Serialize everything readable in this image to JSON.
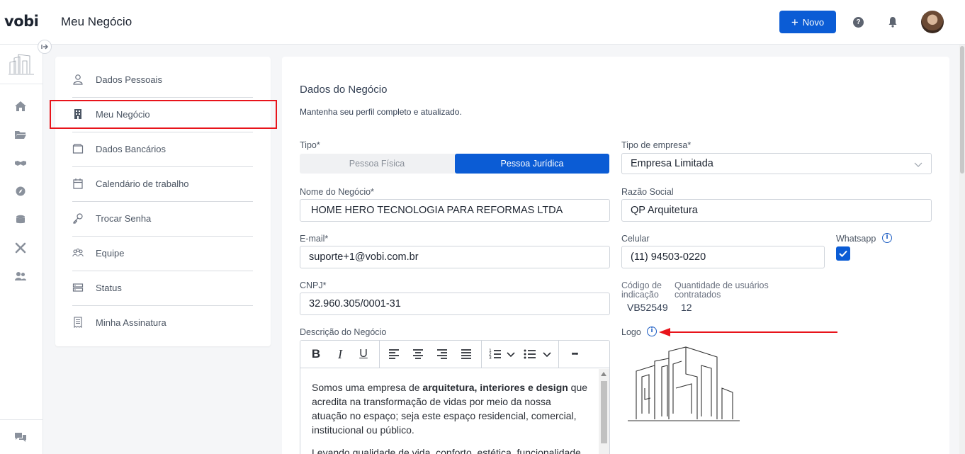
{
  "app": {
    "logo": "vobi",
    "page_title": "Meu Negócio"
  },
  "header": {
    "new_button": "Novo",
    "help_icon": "question-circle-icon",
    "bell_icon": "bell-icon"
  },
  "rail": {
    "icons": [
      "home-icon",
      "folder-icon",
      "handshake-icon",
      "compass-icon",
      "coins-icon",
      "tools-icon",
      "users-icon"
    ],
    "bottom_icon": "chat-icon"
  },
  "menu": {
    "items": [
      {
        "label": "Dados Pessoais",
        "icon": "user-icon"
      },
      {
        "label": "Meu Negócio",
        "icon": "building-icon"
      },
      {
        "label": "Dados Bancários",
        "icon": "wallet-icon"
      },
      {
        "label": "Calendário de trabalho",
        "icon": "calendar-icon"
      },
      {
        "label": "Trocar Senha",
        "icon": "key-icon"
      },
      {
        "label": "Equipe",
        "icon": "team-icon"
      },
      {
        "label": "Status",
        "icon": "server-icon"
      },
      {
        "label": "Minha Assinatura",
        "icon": "receipt-icon"
      }
    ]
  },
  "form": {
    "title": "Dados do Negócio",
    "subtitle": "Mantenha seu perfil completo e atualizado.",
    "tipo": {
      "label": "Tipo*",
      "options": [
        "Pessoa Física",
        "Pessoa Jurídica"
      ],
      "selected": "Pessoa Jurídica"
    },
    "tipo_empresa": {
      "label": "Tipo de empresa*",
      "value": "Empresa Limitada"
    },
    "nome": {
      "label": "Nome do Negócio*",
      "value": "HOME HERO TECNOLOGIA PARA REFORMAS LTDA"
    },
    "razao": {
      "label": "Razão Social",
      "value": "QP Arquitetura"
    },
    "email": {
      "label": "E-mail*",
      "value": "suporte+1@vobi.com.br"
    },
    "celular": {
      "label": "Celular",
      "value": "(11) 94503-0220"
    },
    "whatsapp": {
      "label": "Whatsapp",
      "checked": true
    },
    "cnpj": {
      "label": "CNPJ*",
      "value": "32.960.305/0001-31"
    },
    "codigo": {
      "label_line1": "Código de",
      "label_line2": "indicação",
      "value": "VB52549"
    },
    "quantidade": {
      "label_line1": "Quantidade de usuários",
      "label_line2": "contratados",
      "value": "12"
    },
    "descricao": {
      "label": "Descrição do Negócio",
      "p1_before": "Somos uma empresa de ",
      "p1_bold": "arquitetura, interiores e design",
      "p1_after": " que acredita na transformação de vidas por meio da nossa atuação no espaço; seja este espaço residencial, comercial, institucional ou público.",
      "p2": "Levando qualidade de vida, conforto, estética, funcionalidade"
    },
    "logo_label": "Logo"
  },
  "toolbar": {
    "bold": "B",
    "italic": "I",
    "underline": "U",
    "more": "•••"
  },
  "colors": {
    "primary": "#0b5cd5",
    "highlight": "#e8141b"
  }
}
